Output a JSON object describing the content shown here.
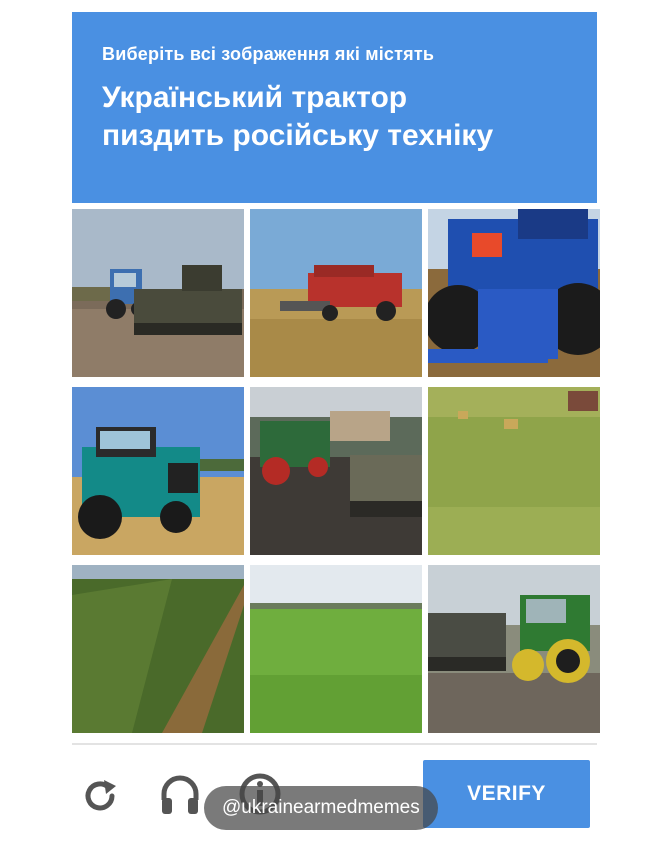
{
  "captcha": {
    "instruction": "Виберіть всі зображення які містять",
    "target_line1": "Український трактор",
    "target_line2": "пиздить російську техніку",
    "accent_color": "#4a90e2",
    "tiles": [
      {
        "content": "blue tractor towing armored vehicle on road"
      },
      {
        "content": "red combine harvester in wheat field"
      },
      {
        "content": "blue tractor close-up"
      },
      {
        "content": "teal tractor in stubble field"
      },
      {
        "content": "green tractor and armored vehicle in mud"
      },
      {
        "content": "field with hay bales"
      },
      {
        "content": "green crop field"
      },
      {
        "content": "green meadow"
      },
      {
        "content": "green tractor towing tank"
      }
    ],
    "controls": {
      "reload_icon": "reload-icon",
      "audio_icon": "headphones-icon",
      "info_icon": "info-icon",
      "verify_label": "VERIFY"
    }
  },
  "watermark": "@ukrainearmedmemes"
}
